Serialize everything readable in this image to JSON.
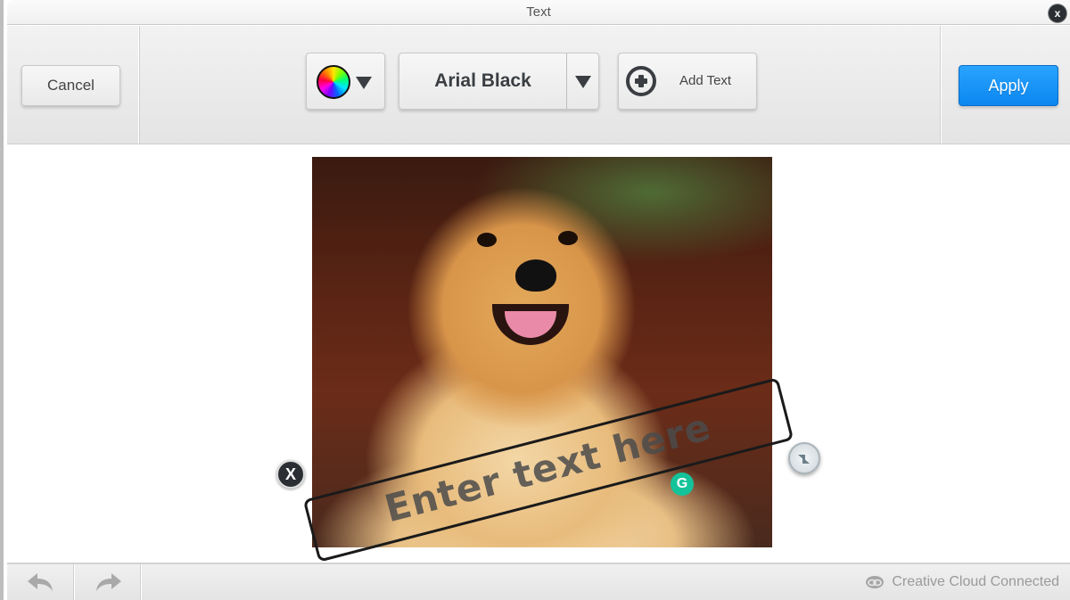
{
  "window": {
    "title": "Text",
    "close_label": "x"
  },
  "toolbar": {
    "cancel_label": "Cancel",
    "apply_label": "Apply",
    "color_picker": {
      "icon": "color-wheel-icon"
    },
    "font_select": {
      "value": "Arial Black"
    },
    "add_text_label": "Add Text",
    "accent_color": "#1196f7"
  },
  "canvas": {
    "image_subject": "golden retriever puppy",
    "text_box": {
      "placeholder": "Enter text here",
      "delete_handle_label": "X",
      "rotate_handle": "rotate-scale-icon",
      "grammarly_label": "G"
    }
  },
  "footer": {
    "undo_icon": "undo-icon",
    "redo_icon": "redo-icon",
    "status": "Creative Cloud Connected"
  }
}
